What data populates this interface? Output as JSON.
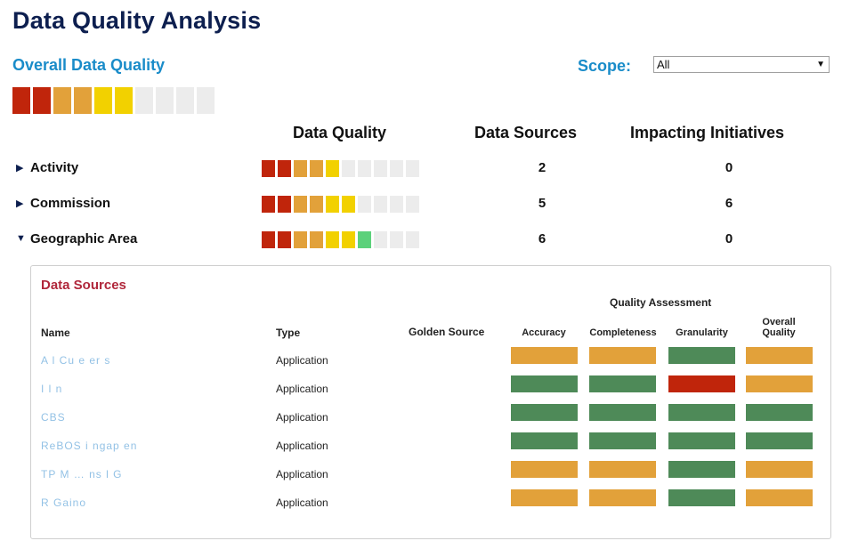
{
  "page": {
    "title": "Data Quality Analysis",
    "overall_label": "Overall Data Quality",
    "scope_label": "Scope:",
    "scope_value": "All"
  },
  "colors": {
    "red": "#c0250b",
    "orange": "#e2a13a",
    "yellow": "#f2d100",
    "green": "#5cd17b",
    "dark_green": "#4e8a58",
    "empty": "#ececec",
    "title_navy": "#0d1f4f",
    "accent_blue": "#1a8cc9",
    "ds_title_red": "#b0273b"
  },
  "overall_quality": [
    "red",
    "red",
    "orange",
    "orange",
    "yellow",
    "yellow",
    "empty",
    "empty",
    "empty",
    "empty"
  ],
  "table": {
    "headers": {
      "quality": "Data Quality",
      "sources": "Data Sources",
      "initiatives": "Impacting Initiatives"
    },
    "rows": [
      {
        "label": "Activity",
        "expanded": false,
        "quality": [
          "red",
          "red",
          "orange",
          "orange",
          "yellow",
          "empty",
          "empty",
          "empty",
          "empty",
          "empty"
        ],
        "sources": "2",
        "initiatives": "0"
      },
      {
        "label": "Commission",
        "expanded": false,
        "quality": [
          "red",
          "red",
          "orange",
          "orange",
          "yellow",
          "yellow",
          "empty",
          "empty",
          "empty",
          "empty"
        ],
        "sources": "5",
        "initiatives": "6"
      },
      {
        "label": "Geographic Area",
        "expanded": true,
        "quality": [
          "red",
          "red",
          "orange",
          "orange",
          "yellow",
          "yellow",
          "green",
          "empty",
          "empty",
          "empty"
        ],
        "sources": "6",
        "initiatives": "0"
      }
    ]
  },
  "data_sources": {
    "title": "Data Sources",
    "quality_assessment_label": "Quality Assessment",
    "col_name": "Name",
    "col_type": "Type",
    "col_golden": "Golden Source",
    "col_accuracy": "Accuracy",
    "col_completeness": "Completeness",
    "col_granularity": "Granularity",
    "col_overall": "Overall Quality",
    "rows": [
      {
        "name": "A l Cu   e   er  s",
        "type": "Application",
        "golden": "",
        "accuracy": "orange",
        "completeness": "orange",
        "granularity": "dark_green",
        "overall": "orange"
      },
      {
        "name": "I  l  n",
        "type": "Application",
        "golden": "",
        "accuracy": "dark_green",
        "completeness": "dark_green",
        "granularity": "red",
        "overall": "orange"
      },
      {
        "name": "CBS",
        "type": "Application",
        "golden": "",
        "accuracy": "dark_green",
        "completeness": "dark_green",
        "granularity": "dark_green",
        "overall": "dark_green"
      },
      {
        "name": "ReBOS  i  ngap  en",
        "type": "Application",
        "golden": "",
        "accuracy": "dark_green",
        "completeness": "dark_green",
        "granularity": "dark_green",
        "overall": "dark_green"
      },
      {
        "name": "TP M …   ns   l G  ",
        "type": "Application",
        "golden": "",
        "accuracy": "orange",
        "completeness": "orange",
        "granularity": "dark_green",
        "overall": "orange"
      },
      {
        "name": "R Gaino",
        "type": "Application",
        "golden": "",
        "accuracy": "orange",
        "completeness": "orange",
        "granularity": "dark_green",
        "overall": "orange"
      }
    ]
  }
}
